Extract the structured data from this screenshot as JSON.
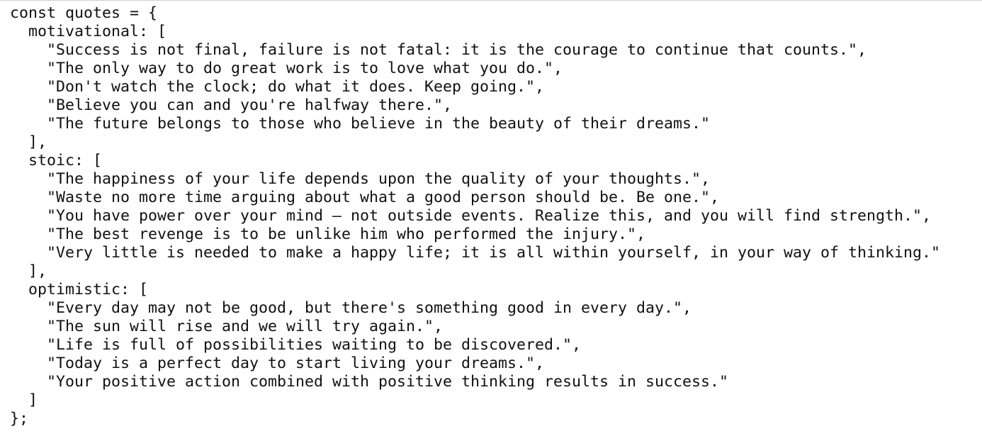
{
  "code": {
    "lines": [
      "const quotes = {",
      "  motivational: [",
      "    \"Success is not final, failure is not fatal: it is the courage to continue that counts.\",",
      "    \"The only way to do great work is to love what you do.\",",
      "    \"Don't watch the clock; do what it does. Keep going.\",",
      "    \"Believe you can and you're halfway there.\",",
      "    \"The future belongs to those who believe in the beauty of their dreams.\"",
      "  ],",
      "  stoic: [",
      "    \"The happiness of your life depends upon the quality of your thoughts.\",",
      "    \"Waste no more time arguing about what a good person should be. Be one.\",",
      "    \"You have power over your mind – not outside events. Realize this, and you will find strength.\",",
      "    \"The best revenge is to be unlike him who performed the injury.\",",
      "    \"Very little is needed to make a happy life; it is all within yourself, in your way of thinking.\"",
      "  ],",
      "  optimistic: [",
      "    \"Every day may not be good, but there's something good in every day.\",",
      "    \"The sun will rise and we will try again.\",",
      "    \"Life is full of possibilities waiting to be discovered.\",",
      "    \"Today is a perfect day to start living your dreams.\",",
      "    \"Your positive action combined with positive thinking results in success.\"",
      "  ]",
      "};"
    ]
  }
}
